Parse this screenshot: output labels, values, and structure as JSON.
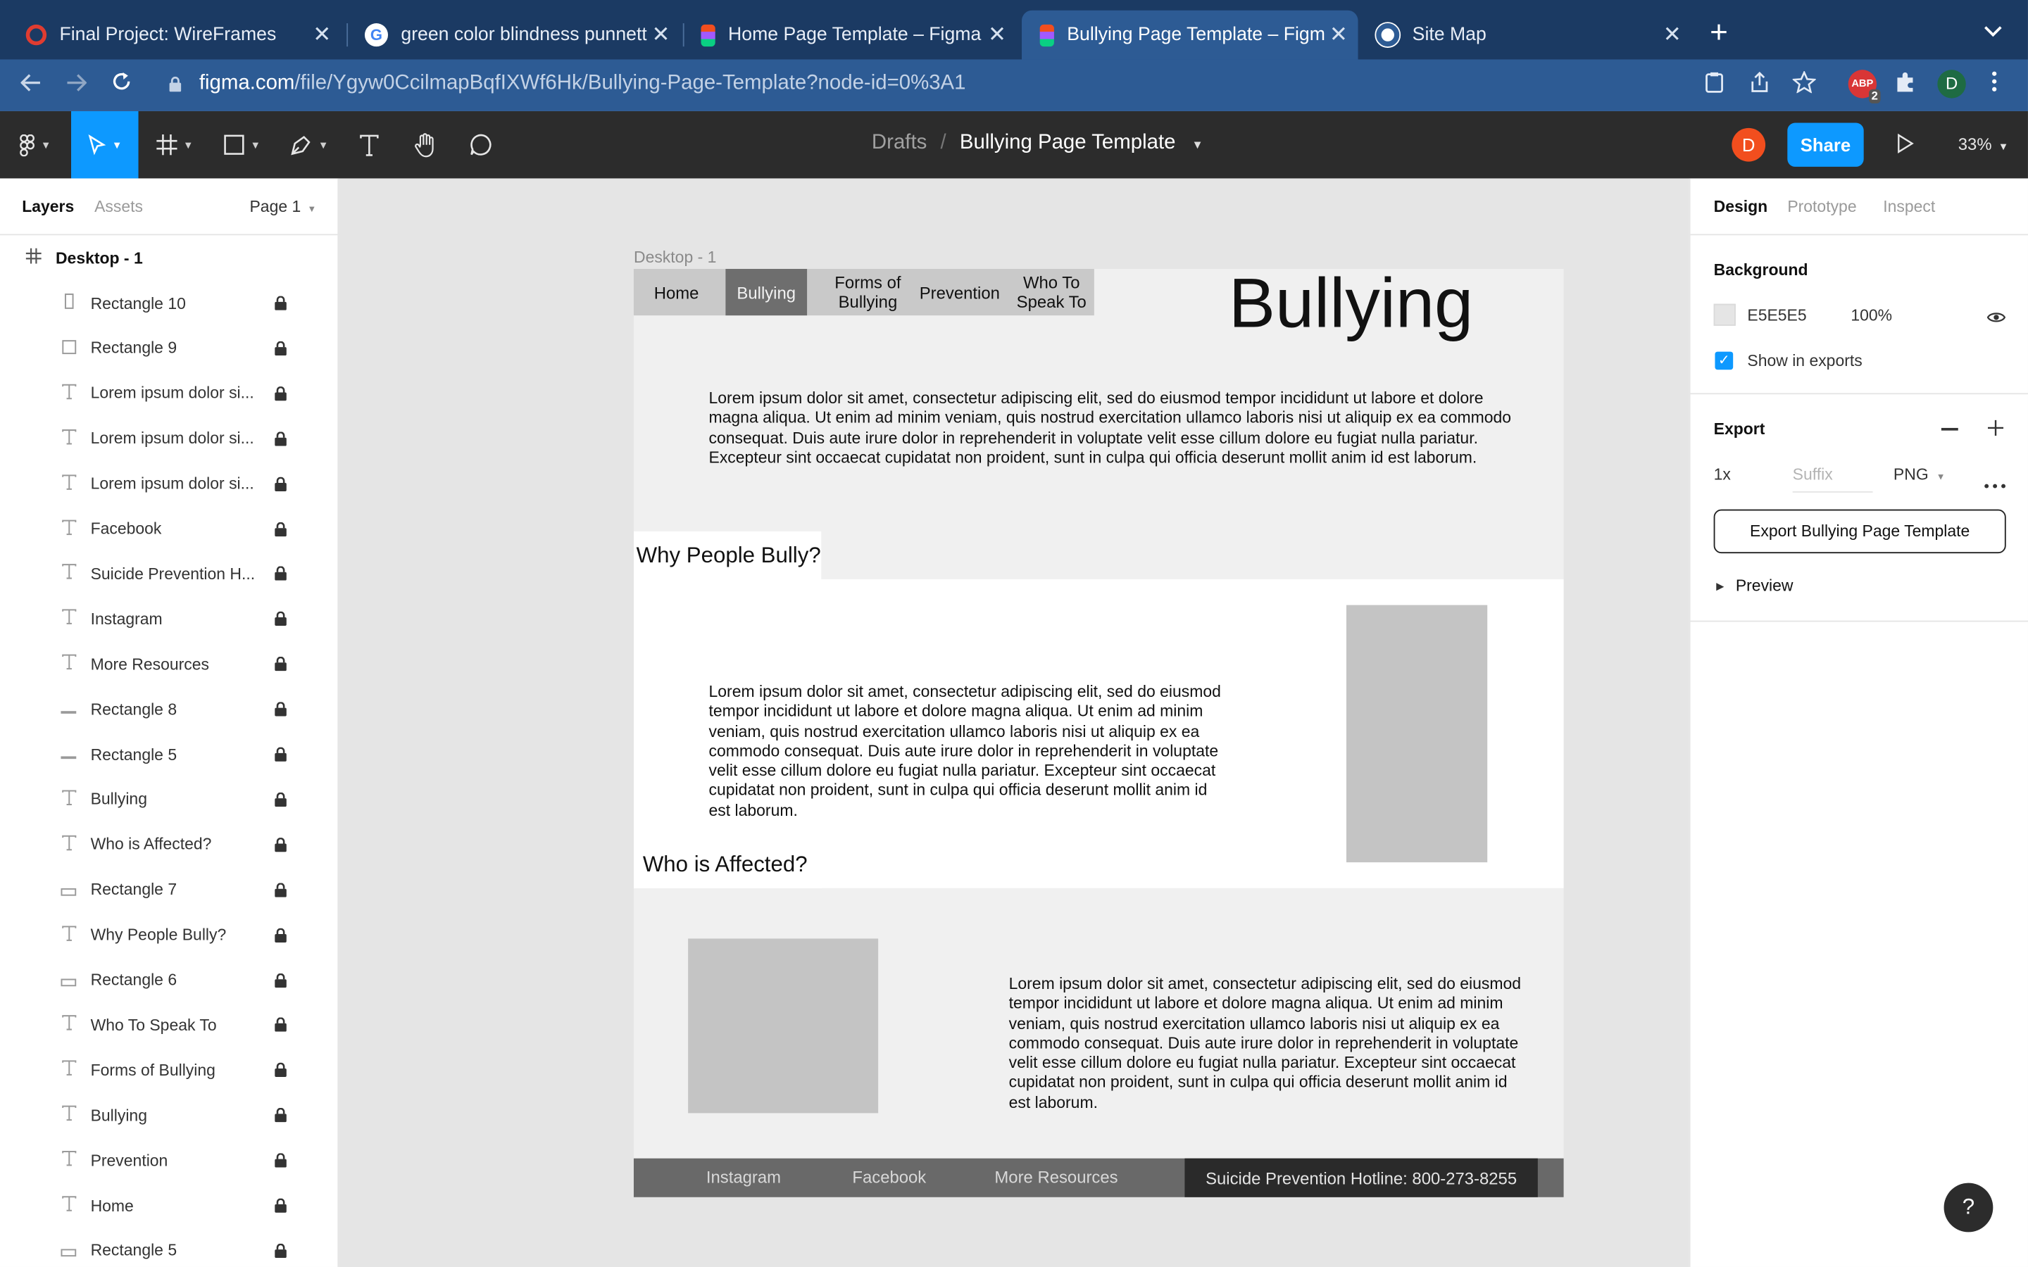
{
  "browser": {
    "tabs": [
      {
        "title": "Final Project: WireFrames",
        "active": false
      },
      {
        "title": "green color blindness punnett s",
        "active": false
      },
      {
        "title": "Home Page Template – Figma",
        "active": false
      },
      {
        "title": "Bullying Page Template – Figma",
        "active": true
      },
      {
        "title": "Site Map",
        "active": false
      }
    ],
    "url_host": "figma.com",
    "url_path": "/file/Ygyw0CcilmapBqfIXWf6Hk/Bullying-Page-Template?node-id=0%3A1",
    "ext_badge": "2",
    "profile_initial": "D"
  },
  "figma": {
    "breadcrumb_parent": "Drafts",
    "breadcrumb_sep": "/",
    "file_name": "Bullying Page Template",
    "user_initial": "D",
    "share_label": "Share",
    "zoom": "33%"
  },
  "left_panel": {
    "tab_layers": "Layers",
    "tab_assets": "Assets",
    "page_label": "Page 1",
    "frame_name": "Desktop - 1",
    "layers": [
      {
        "name": "Rectangle 10",
        "icon": "rect-tall"
      },
      {
        "name": "Rectangle 9",
        "icon": "rect"
      },
      {
        "name": "Lorem ipsum dolor si...",
        "icon": "text"
      },
      {
        "name": "Lorem ipsum dolor si...",
        "icon": "text"
      },
      {
        "name": "Lorem ipsum dolor si...",
        "icon": "text"
      },
      {
        "name": "Facebook",
        "icon": "text"
      },
      {
        "name": "Suicide Prevention H...",
        "icon": "text"
      },
      {
        "name": "Instagram",
        "icon": "text"
      },
      {
        "name": "More Resources",
        "icon": "text"
      },
      {
        "name": "Rectangle 8",
        "icon": "line"
      },
      {
        "name": "Rectangle 5",
        "icon": "line"
      },
      {
        "name": "Bullying",
        "icon": "text"
      },
      {
        "name": "Who is Affected?",
        "icon": "text"
      },
      {
        "name": "Rectangle 7",
        "icon": "rect-flat"
      },
      {
        "name": "Why People Bully?",
        "icon": "text"
      },
      {
        "name": "Rectangle 6",
        "icon": "rect-flat"
      },
      {
        "name": "Who To Speak To",
        "icon": "text"
      },
      {
        "name": "Forms of Bullying",
        "icon": "text"
      },
      {
        "name": "Bullying",
        "icon": "text"
      },
      {
        "name": "Prevention",
        "icon": "text"
      },
      {
        "name": "Home",
        "icon": "text"
      },
      {
        "name": "Rectangle 5",
        "icon": "rect-flat"
      }
    ]
  },
  "canvas": {
    "frame_label": "Desktop - 1",
    "nav": [
      "Home",
      "Bullying",
      "Forms of Bullying",
      "Prevention",
      "Who To Speak To"
    ],
    "nav_active_index": 1,
    "title": "Bullying",
    "intro": "Lorem ipsum dolor sit amet, consectetur adipiscing elit, sed do eiusmod tempor incididunt ut labore et dolore magna aliqua. Ut enim ad minim veniam, quis nostrud exercitation ullamco laboris nisi ut aliquip ex ea commodo consequat. Duis aute irure dolor in reprehenderit in voluptate velit esse cillum dolore eu fugiat nulla pariatur. Excepteur sint occaecat cupidatat non proident, sunt in culpa qui officia deserunt mollit anim id est laborum.",
    "heading_why": "Why People Bully?",
    "why_text": "Lorem ipsum dolor sit amet, consectetur adipiscing elit, sed do eiusmod tempor incididunt ut labore et dolore magna aliqua. Ut enim ad minim veniam, quis nostrud exercitation ullamco laboris nisi ut aliquip ex ea commodo consequat. Duis aute irure dolor in reprehenderit in voluptate velit esse cillum dolore eu fugiat nulla pariatur. Excepteur sint occaecat cupidatat non proident, sunt in culpa qui officia deserunt mollit anim id est laborum.",
    "heading_who": "Who is Affected?",
    "who_text": "Lorem ipsum dolor sit amet, consectetur adipiscing elit, sed do eiusmod tempor incididunt ut labore et dolore magna aliqua. Ut enim ad minim veniam, quis nostrud exercitation ullamco laboris nisi ut aliquip ex ea commodo consequat. Duis aute irure dolor in reprehenderit in voluptate velit esse cillum dolore eu fugiat nulla pariatur. Excepteur sint occaecat cupidatat non proident, sunt in culpa qui officia deserunt mollit anim id est laborum.",
    "footer_links": [
      "Instagram",
      "Facebook",
      "More Resources"
    ],
    "hotline": "Suicide Prevention Hotline:  800-273-8255"
  },
  "right_panel": {
    "tab_design": "Design",
    "tab_prototype": "Prototype",
    "tab_inspect": "Inspect",
    "background_heading": "Background",
    "bg_hex": "E5E5E5",
    "bg_opacity": "100%",
    "show_in_exports": "Show in exports",
    "export_heading": "Export",
    "export_scale": "1x",
    "suffix_placeholder": "Suffix",
    "export_format": "PNG",
    "export_button": "Export Bullying Page Template",
    "preview_label": "Preview"
  },
  "help_label": "?",
  "colors": {
    "browser_tabbar": "#1b3a63",
    "browser_active": "#2d5b94",
    "figma_toolbar": "#2c2c2c",
    "figma_accent": "#0d99ff",
    "canvas_bg": "#e5e5e5",
    "frame_bg": "#f0f0f0",
    "placeholder": "#c4c4c4"
  }
}
